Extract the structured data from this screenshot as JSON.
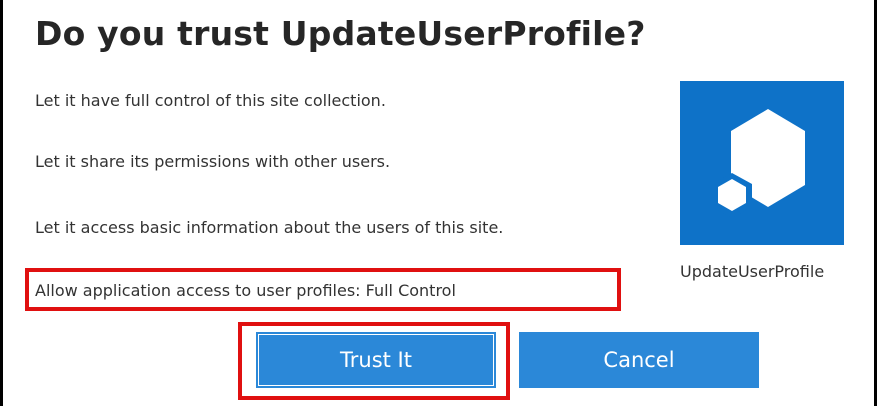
{
  "dialog": {
    "title": "Do you trust UpdateUserProfile?",
    "permissions": [
      "Let it have full control of this site collection.",
      "Let it share its permissions with other users.",
      "Let it access basic information about the users of this site.",
      "Allow application access to user profiles: Full Control"
    ],
    "app": {
      "name": "UpdateUserProfile",
      "icon": "app-cube-icon",
      "tile_color": "#0e72c8"
    },
    "buttons": {
      "trust_label": "Trust It",
      "cancel_label": "Cancel"
    },
    "colors": {
      "button": "#2b88d8",
      "highlight": "#e01010"
    }
  }
}
